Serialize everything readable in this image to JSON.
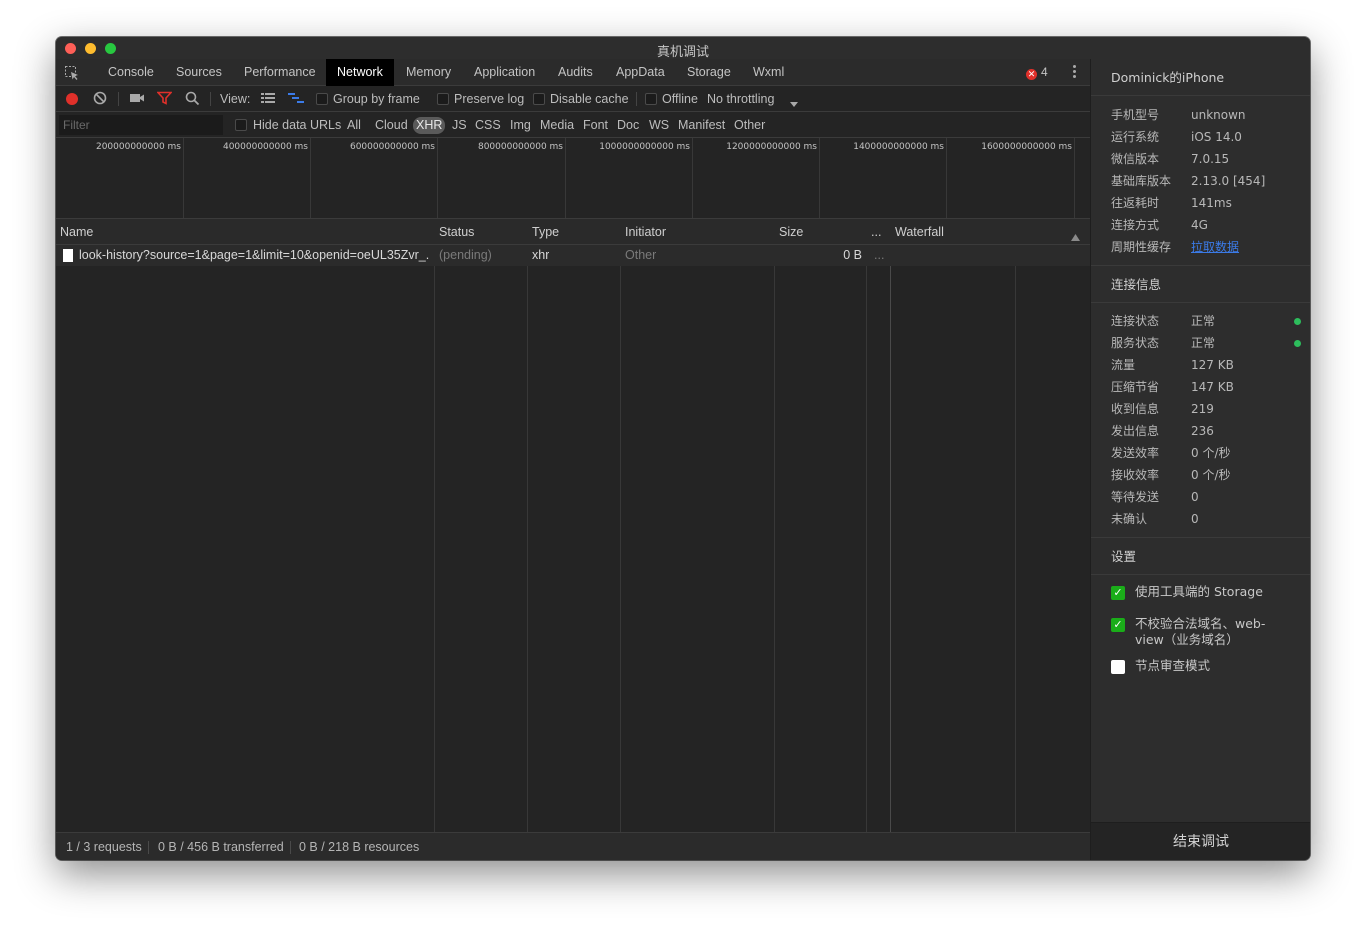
{
  "window": {
    "title": "真机调试"
  },
  "tabs": [
    {
      "label": "Console"
    },
    {
      "label": "Sources"
    },
    {
      "label": "Performance"
    },
    {
      "label": "Network"
    },
    {
      "label": "Memory"
    },
    {
      "label": "Application"
    },
    {
      "label": "Audits"
    },
    {
      "label": "AppData"
    },
    {
      "label": "Storage"
    },
    {
      "label": "Wxml"
    }
  ],
  "active_tab": "Network",
  "error_count": "4",
  "toolbar": {
    "view_label": "View:",
    "group_by_frame": "Group by frame",
    "preserve_log": "Preserve log",
    "disable_cache": "Disable cache",
    "offline": "Offline",
    "throttling": "No throttling"
  },
  "filter": {
    "placeholder": "Filter",
    "hide_data_urls": "Hide data URLs",
    "types": [
      "All",
      "Cloud",
      "XHR",
      "JS",
      "CSS",
      "Img",
      "Media",
      "Font",
      "Doc",
      "WS",
      "Manifest",
      "Other"
    ],
    "selected": "XHR"
  },
  "overview": {
    "ticks": [
      "200000000000 ms",
      "400000000000 ms",
      "600000000000 ms",
      "800000000000 ms",
      "1000000000000 ms",
      "1200000000000 ms",
      "1400000000000 ms",
      "1600000000000 ms"
    ]
  },
  "table": {
    "columns": [
      "Name",
      "Status",
      "Type",
      "Initiator",
      "Size",
      "...",
      "Waterfall"
    ],
    "rows": [
      {
        "name": "look-history?source=1&page=1&limit=10&openid=oeUL35Zvr_...",
        "status": "(pending)",
        "type": "xhr",
        "initiator": "Other",
        "size": "0 B",
        "time": "..."
      }
    ]
  },
  "statusbar": {
    "requests": "1 / 3 requests",
    "transferred": "0 B / 456 B transferred",
    "resources": "0 B / 218 B resources"
  },
  "side": {
    "device_title": "Dominick的iPhone",
    "device_info": [
      {
        "key": "手机型号",
        "value": "unknown"
      },
      {
        "key": "运行系统",
        "value": "iOS 14.0"
      },
      {
        "key": "微信版本",
        "value": "7.0.15"
      },
      {
        "key": "基础库版本",
        "value": "2.13.0 [454]"
      },
      {
        "key": "往返耗时",
        "value": "141ms"
      },
      {
        "key": "连接方式",
        "value": "4G"
      },
      {
        "key": "周期性缓存",
        "value": "拉取数据"
      }
    ],
    "connection_title": "连接信息",
    "connection_info": [
      {
        "key": "连接状态",
        "value": "正常"
      },
      {
        "key": "服务状态",
        "value": "正常"
      },
      {
        "key": "流量",
        "value": "127 KB"
      },
      {
        "key": "压缩节省",
        "value": "147 KB"
      },
      {
        "key": "收到信息",
        "value": "219"
      },
      {
        "key": "发出信息",
        "value": "236"
      },
      {
        "key": "发送效率",
        "value": "0 个/秒"
      },
      {
        "key": "接收效率",
        "value": "0 个/秒"
      },
      {
        "key": "等待发送",
        "value": "0"
      },
      {
        "key": "未确认",
        "value": "0"
      }
    ],
    "settings_title": "设置",
    "settings": [
      {
        "label": "使用工具端的 Storage",
        "checked": true
      },
      {
        "label": "不校验合法域名、web-view（业务域名）",
        "checked": true
      },
      {
        "label": "节点审查模式",
        "checked": false
      }
    ],
    "end_button": "结束调试"
  },
  "colors": {
    "accent_green": "#1aad19",
    "record_red": "#e0302a",
    "link_blue": "#3b7be8",
    "status_dot": "#2dbd5c"
  }
}
